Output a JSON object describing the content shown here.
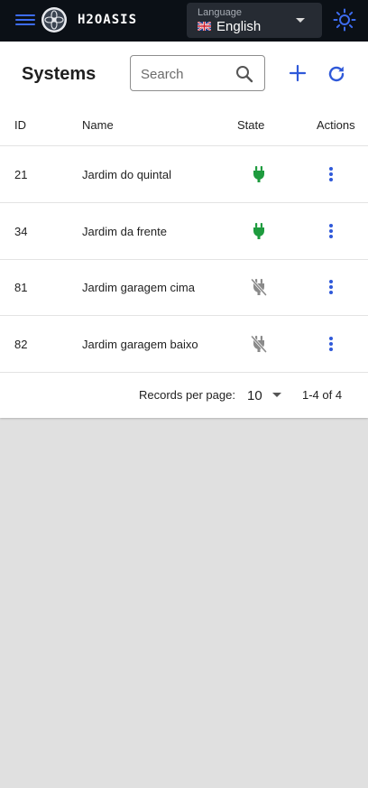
{
  "appbar": {
    "brand": "H2OASIS",
    "language": {
      "caption": "Language",
      "value": "English"
    }
  },
  "page": {
    "title": "Systems",
    "search_placeholder": "Search"
  },
  "table": {
    "headers": {
      "id": "ID",
      "name": "Name",
      "state": "State",
      "actions": "Actions"
    },
    "rows": [
      {
        "id": "21",
        "name": "Jardim do quintal",
        "state": "connected"
      },
      {
        "id": "34",
        "name": "Jardim da frente",
        "state": "connected"
      },
      {
        "id": "81",
        "name": "Jardim garagem cima",
        "state": "disconnected"
      },
      {
        "id": "82",
        "name": "Jardim garagem baixo",
        "state": "disconnected"
      }
    ]
  },
  "pagination": {
    "records_per_page_label": "Records per page:",
    "records_per_page": "10",
    "range": "1-4 of 4"
  },
  "colors": {
    "appbar_bg": "#0b1016",
    "accent": "#2f59d9",
    "connected": "#1e9b3e",
    "disconnected": "#8a8a8a"
  },
  "icons": {
    "menu": "menu-icon",
    "logo": "flower-logo",
    "theme": "sun-icon",
    "search": "search-icon",
    "add": "plus-icon",
    "refresh": "refresh-icon",
    "connected": "plug-icon",
    "disconnected": "plug-off-icon",
    "actions": "more-vertical-icon"
  }
}
